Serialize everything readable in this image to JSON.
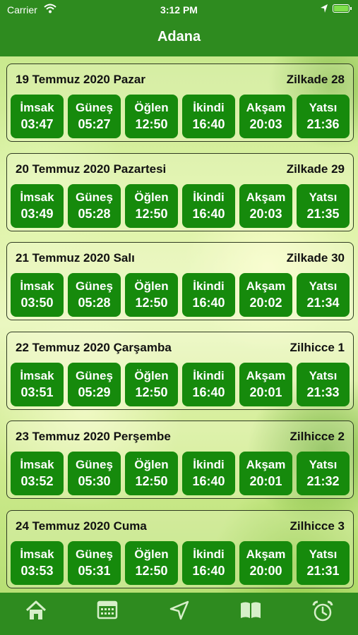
{
  "status": {
    "carrier": "Carrier",
    "time": "3:12 PM"
  },
  "header": {
    "title": "Adana"
  },
  "days": [
    {
      "date": "19 Temmuz 2020 Pazar",
      "hijri": "Zilkade 28",
      "times": [
        {
          "name": "İmsak",
          "time": "03:47"
        },
        {
          "name": "Güneş",
          "time": "05:27"
        },
        {
          "name": "Öğlen",
          "time": "12:50"
        },
        {
          "name": "İkindi",
          "time": "16:40"
        },
        {
          "name": "Akşam",
          "time": "20:03"
        },
        {
          "name": "Yatsı",
          "time": "21:36"
        }
      ]
    },
    {
      "date": "20 Temmuz 2020 Pazartesi",
      "hijri": "Zilkade 29",
      "times": [
        {
          "name": "İmsak",
          "time": "03:49"
        },
        {
          "name": "Güneş",
          "time": "05:28"
        },
        {
          "name": "Öğlen",
          "time": "12:50"
        },
        {
          "name": "İkindi",
          "time": "16:40"
        },
        {
          "name": "Akşam",
          "time": "20:03"
        },
        {
          "name": "Yatsı",
          "time": "21:35"
        }
      ]
    },
    {
      "date": "21 Temmuz 2020 Salı",
      "hijri": "Zilkade 30",
      "times": [
        {
          "name": "İmsak",
          "time": "03:50"
        },
        {
          "name": "Güneş",
          "time": "05:28"
        },
        {
          "name": "Öğlen",
          "time": "12:50"
        },
        {
          "name": "İkindi",
          "time": "16:40"
        },
        {
          "name": "Akşam",
          "time": "20:02"
        },
        {
          "name": "Yatsı",
          "time": "21:34"
        }
      ]
    },
    {
      "date": "22 Temmuz 2020 Çarşamba",
      "hijri": "Zilhicce 1",
      "times": [
        {
          "name": "İmsak",
          "time": "03:51"
        },
        {
          "name": "Güneş",
          "time": "05:29"
        },
        {
          "name": "Öğlen",
          "time": "12:50"
        },
        {
          "name": "İkindi",
          "time": "16:40"
        },
        {
          "name": "Akşam",
          "time": "20:01"
        },
        {
          "name": "Yatsı",
          "time": "21:33"
        }
      ]
    },
    {
      "date": "23 Temmuz 2020 Perşembe",
      "hijri": "Zilhicce 2",
      "times": [
        {
          "name": "İmsak",
          "time": "03:52"
        },
        {
          "name": "Güneş",
          "time": "05:30"
        },
        {
          "name": "Öğlen",
          "time": "12:50"
        },
        {
          "name": "İkindi",
          "time": "16:40"
        },
        {
          "name": "Akşam",
          "time": "20:01"
        },
        {
          "name": "Yatsı",
          "time": "21:32"
        }
      ]
    },
    {
      "date": "24 Temmuz 2020 Cuma",
      "hijri": "Zilhicce 3",
      "times": [
        {
          "name": "İmsak",
          "time": "03:53"
        },
        {
          "name": "Güneş",
          "time": "05:31"
        },
        {
          "name": "Öğlen",
          "time": "12:50"
        },
        {
          "name": "İkindi",
          "time": "16:40"
        },
        {
          "name": "Akşam",
          "time": "20:00"
        },
        {
          "name": "Yatsı",
          "time": "21:31"
        }
      ]
    }
  ],
  "tabs": [
    {
      "icon": "home-icon"
    },
    {
      "icon": "calendar-icon"
    },
    {
      "icon": "location-arrow-icon"
    },
    {
      "icon": "book-icon"
    },
    {
      "icon": "alarm-clock-icon"
    }
  ],
  "colors": {
    "bar": "#2e8b1f",
    "prayer_tile": "#168a0c"
  }
}
